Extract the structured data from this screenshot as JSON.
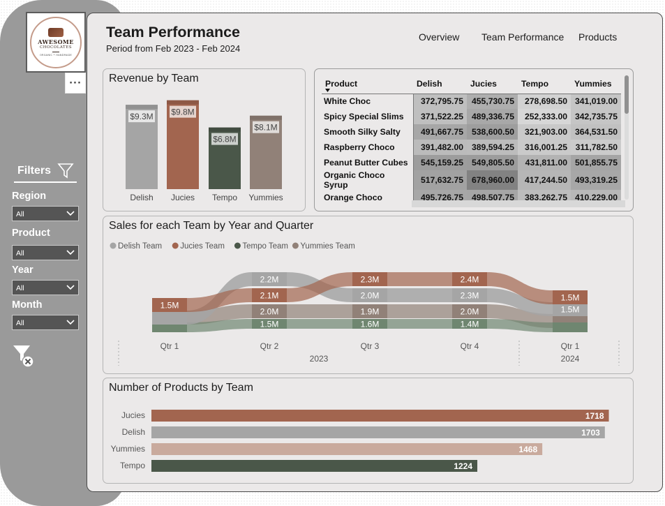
{
  "logo": {
    "line1": "AWESOME",
    "line2": "CHOCOLATES",
    "line3": "ORGANIC • HANDMADE"
  },
  "more_button": "···",
  "filters": {
    "title": "Filters",
    "items": [
      {
        "label": "Region",
        "value": "All"
      },
      {
        "label": "Product",
        "value": "All"
      },
      {
        "label": "Year",
        "value": "All"
      },
      {
        "label": "Month",
        "value": "All"
      }
    ]
  },
  "header": {
    "title": "Team Performance",
    "subtitle": "Period from Feb 2023 - Feb 2024",
    "nav": [
      "Overview",
      "Team Performance",
      "Products"
    ]
  },
  "revenue_card": {
    "title": "Revenue by Team"
  },
  "matrix": {
    "columns": [
      "Product",
      "Delish",
      "Jucies",
      "Tempo",
      "Yummies"
    ],
    "rows": [
      {
        "product": "White Choc",
        "values": [
          "372,795.75",
          "455,730.75",
          "278,698.50",
          "341,019.00"
        ]
      },
      {
        "product": "Spicy Special Slims",
        "values": [
          "371,522.25",
          "489,336.75",
          "252,333.00",
          "342,735.75"
        ]
      },
      {
        "product": "Smooth Silky Salty",
        "values": [
          "491,667.75",
          "538,600.50",
          "321,903.00",
          "364,531.50"
        ]
      },
      {
        "product": "Raspberry Choco",
        "values": [
          "391,482.00",
          "389,594.25",
          "316,001.25",
          "311,782.50"
        ]
      },
      {
        "product": "Peanut Butter Cubes",
        "values": [
          "545,159.25",
          "549,805.50",
          "431,811.00",
          "501,855.75"
        ]
      },
      {
        "product": "Organic Choco Syrup",
        "values": [
          "517,632.75",
          "678,960.00",
          "417,244.50",
          "493,319.25"
        ]
      },
      {
        "product": "Orange Choco",
        "values": [
          "495,726.75",
          "498,507.75",
          "383,262.75",
          "410,229.00"
        ]
      }
    ]
  },
  "ribbon_card": {
    "title": "Sales for each Team by Year and Quarter"
  },
  "products_card": {
    "title": "Number of Products by Team"
  },
  "colors": {
    "delish": "#a5a5a5",
    "jucies": "#a2654f",
    "tempo": "#4a5749",
    "yummies": "#918178",
    "yummies_light": "#c9aa9d"
  },
  "chart_data": [
    {
      "type": "bar",
      "title": "Revenue by Team",
      "categories": [
        "Delish",
        "Jucies",
        "Tempo",
        "Yummies"
      ],
      "values": [
        9.3,
        9.8,
        6.8,
        8.1
      ],
      "data_labels": [
        "$9.3M",
        "$9.8M",
        "$6.8M",
        "$8.1M"
      ],
      "ylim": [
        0,
        10
      ]
    },
    {
      "type": "area",
      "subtype": "ribbon",
      "title": "Sales for each Team by Year and Quarter",
      "legend_position": "top-left",
      "legend": [
        "Delish Team",
        "Jucies Team",
        "Tempo Team",
        "Yummies Team"
      ],
      "categories": [
        "Qtr 1",
        "Qtr 2",
        "Qtr 3",
        "Qtr 4",
        "Qtr 1"
      ],
      "year_labels": [
        "2023",
        "2024"
      ],
      "series": [
        {
          "name": "Delish Team",
          "values": [
            null,
            2.2,
            2.0,
            2.3,
            1.5
          ],
          "labels": [
            "",
            "2.2M",
            "2.0M",
            "2.3M",
            "1.5M"
          ]
        },
        {
          "name": "Jucies Team",
          "values": [
            1.5,
            2.1,
            2.3,
            2.4,
            1.5
          ],
          "labels": [
            "1.5M",
            "2.1M",
            "2.3M",
            "2.4M",
            "1.5M"
          ]
        },
        {
          "name": "Tempo Team",
          "values": [
            null,
            1.5,
            1.6,
            1.4,
            null
          ],
          "labels": [
            "",
            "1.5M",
            "1.6M",
            "1.4M",
            ""
          ]
        },
        {
          "name": "Yummies Team",
          "values": [
            null,
            2.0,
            1.9,
            2.0,
            null
          ],
          "labels": [
            "",
            "2.0M",
            "1.9M",
            "2.0M",
            ""
          ]
        }
      ]
    },
    {
      "type": "bar",
      "orientation": "horizontal",
      "title": "Number of Products by Team",
      "categories": [
        "Jucies",
        "Delish",
        "Yummies",
        "Tempo"
      ],
      "values": [
        1718,
        1703,
        1468,
        1224
      ],
      "xlim": [
        0,
        1790
      ]
    }
  ]
}
